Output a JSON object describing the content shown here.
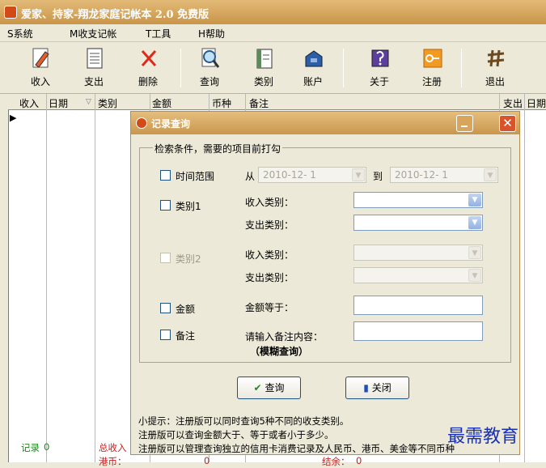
{
  "window": {
    "title": "爱家、持家-翔龙家庭记帐本 2.0 免费版"
  },
  "menu": [
    {
      "label": "S系统"
    },
    {
      "label": "M收支记帐"
    },
    {
      "label": "T工具"
    },
    {
      "label": "H帮助"
    }
  ],
  "toolbar": [
    {
      "label": "收入",
      "icon": "pencil-icon"
    },
    {
      "label": "支出",
      "icon": "notepad-icon"
    },
    {
      "label": "删除",
      "icon": "x-icon"
    },
    {
      "label": "查询",
      "icon": "magnifier-icon"
    },
    {
      "label": "类别",
      "icon": "document-icon"
    },
    {
      "label": "账户",
      "icon": "toolbox-icon"
    },
    {
      "label": "关于",
      "icon": "about-icon"
    },
    {
      "label": "注册",
      "icon": "key-icon"
    },
    {
      "label": "退出",
      "icon": "hash-icon"
    }
  ],
  "grid": {
    "left_headers": [
      "收入",
      "日期",
      "类别",
      "金额",
      "币种",
      "备注"
    ],
    "right_headers": [
      "支出",
      "日期"
    ],
    "bottom": {
      "record_label": "记录",
      "record_value": "0",
      "total_label": "总收入",
      "sub_label": "港币：",
      "sub_value": "0",
      "balance_label": "结余：",
      "balance_value": "0"
    }
  },
  "dialog": {
    "title": "记录查询",
    "group_title": "检索条件，需要的项目前打勾",
    "time": {
      "label": "时间范围",
      "from": "从",
      "from_value": "2010-12- 1",
      "to": "到",
      "to_value": "2010-12- 1"
    },
    "category1": {
      "label": "类别1",
      "income_label": "收入类别：",
      "expense_label": "支出类别：",
      "income_value": "",
      "expense_value": ""
    },
    "category2": {
      "label": "类别2",
      "income_label": "收入类别：",
      "expense_label": "支出类别："
    },
    "amount": {
      "label": "金额",
      "field_label": "金额等于：",
      "value": ""
    },
    "note": {
      "label": "备注",
      "field_label": "请输入备注内容：",
      "fuzzy": "（模糊查询）",
      "value": ""
    },
    "query_button": "查询",
    "close_button": "关闭",
    "hints": [
      "小提示：注册版可以同时查询5种不同的收支类别。",
      "注册版可以查询金额大于、等于或者小于多少。",
      "注册版可以管理查询独立的信用卡消费记录及人民币、港币、美金等不同币种"
    ]
  },
  "watermark": "最需教育",
  "colors": {
    "title_bar": "#c99548",
    "close_button": "#d9542b",
    "status_red": "#c81e1e",
    "status_green": "#1a8a1a",
    "watermark": "#1730b8"
  }
}
